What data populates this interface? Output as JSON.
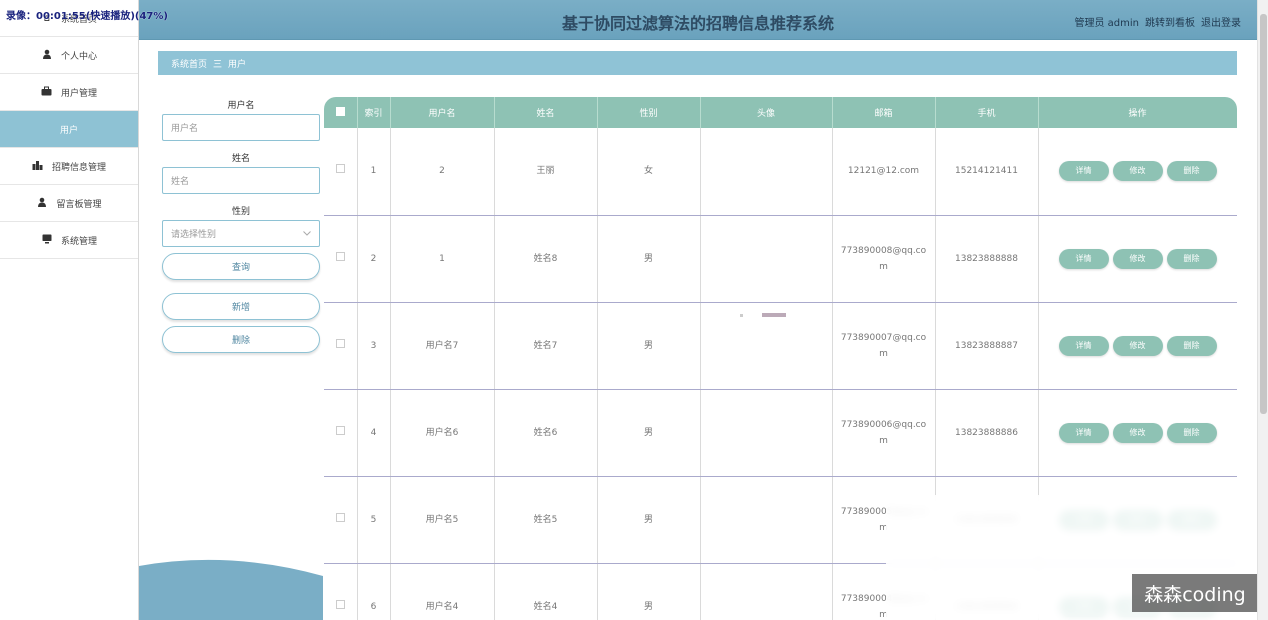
{
  "recording_overlay": "录像：00:01:55(快速播放)(47%)",
  "header": {
    "title": "基于协同过滤算法的招聘信息推荐系统",
    "admin_label": "管理员 admin",
    "dashboard_link": "跳转到看板",
    "logout_link": "退出登录"
  },
  "sidebar": {
    "items": [
      {
        "label": "系统首页",
        "icon": "home-icon"
      },
      {
        "label": "个人中心",
        "icon": "user-icon"
      },
      {
        "label": "用户管理",
        "icon": "briefcase-icon"
      },
      {
        "label": "用户",
        "icon": ""
      },
      {
        "label": "招聘信息管理",
        "icon": "chart-icon"
      },
      {
        "label": "留言板管理",
        "icon": "user-icon"
      },
      {
        "label": "系统管理",
        "icon": "monitor-icon"
      }
    ]
  },
  "breadcrumb": {
    "home": "系统首页",
    "separator": "三",
    "current": "用户"
  },
  "search": {
    "username_label": "用户名",
    "username_placeholder": "用户名",
    "name_label": "姓名",
    "name_placeholder": "姓名",
    "gender_label": "性别",
    "gender_placeholder": "请选择性别",
    "query_button": "查询",
    "add_button": "新增",
    "delete_button": "删除"
  },
  "table": {
    "columns": [
      "索引",
      "用户名",
      "姓名",
      "性别",
      "头像",
      "邮箱",
      "手机",
      "操作"
    ],
    "actions": {
      "detail": "详情",
      "edit": "修改",
      "delete": "删除"
    },
    "rows": [
      {
        "index": "1",
        "username": "2",
        "name": "王丽",
        "gender": "女",
        "email": "12121@12.com",
        "phone": "15214121411"
      },
      {
        "index": "2",
        "username": "1",
        "name": "姓名8",
        "gender": "男",
        "email": "773890008@qq.com",
        "phone": "13823888888"
      },
      {
        "index": "3",
        "username": "用户名7",
        "name": "姓名7",
        "gender": "男",
        "email": "773890007@qq.com",
        "phone": "13823888887"
      },
      {
        "index": "4",
        "username": "用户名6",
        "name": "姓名6",
        "gender": "男",
        "email": "773890006@qq.com",
        "phone": "13823888886"
      },
      {
        "index": "5",
        "username": "用户名5",
        "name": "姓名5",
        "gender": "男",
        "email": "773890005@qq.com",
        "phone": "13823888885"
      },
      {
        "index": "6",
        "username": "用户名4",
        "name": "姓名4",
        "gender": "男",
        "email": "773890004@qq.com",
        "phone": "13823888884"
      }
    ]
  },
  "watermark": "森森coding",
  "colors": {
    "header": "#6aa2bd",
    "breadcrumb": "#8fc3d6",
    "table_header": "#8ec2b4",
    "action_button": "#8ec2b4",
    "sidebar_active": "#8ec2d4"
  }
}
